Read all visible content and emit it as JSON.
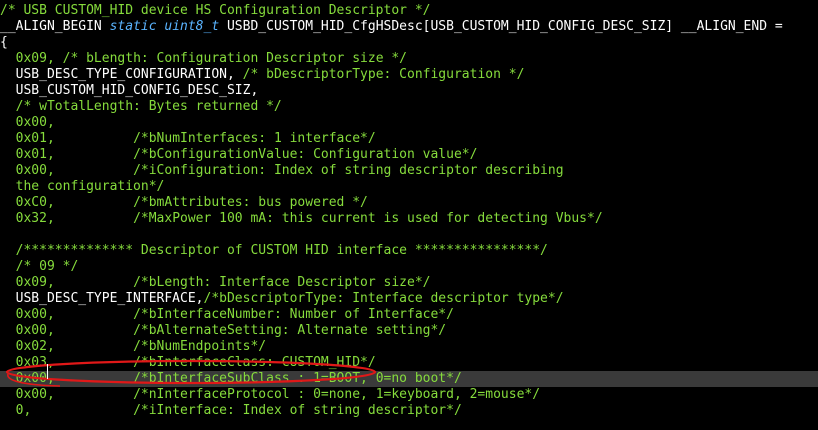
{
  "editor": {
    "colors": {
      "background": "#000000",
      "comment": "#86dc3c",
      "number": "#86dc3c",
      "keyword": "#5ab4ff",
      "plain": "#ffffff",
      "current_line": "#3a3a3a",
      "annotation": "#e01818"
    },
    "current_line_index": 23,
    "lines": [
      [
        {
          "t": "/* USB CUSTOM_HID device HS Configuration Descriptor */",
          "s": "comment"
        }
      ],
      [
        {
          "t": "__ALIGN_BEGIN ",
          "s": "plain"
        },
        {
          "t": "static uint8_t",
          "s": "keyword"
        },
        {
          "t": " USBD_CUSTOM_HID_CfgHSDesc[USB_CUSTOM_HID_CONFIG_DESC_SIZ] __ALIGN_END =",
          "s": "plain"
        }
      ],
      [
        {
          "t": "{",
          "s": "plain"
        }
      ],
      [
        {
          "t": "  0x09, ",
          "s": "number"
        },
        {
          "t": "/* bLength: Configuration Descriptor size */",
          "s": "comment"
        }
      ],
      [
        {
          "t": "  USB_DESC_TYPE_CONFIGURATION, ",
          "s": "plain"
        },
        {
          "t": "/* bDescriptorType: Configuration */",
          "s": "comment"
        }
      ],
      [
        {
          "t": "  USB_CUSTOM_HID_CONFIG_DESC_SIZ,",
          "s": "plain"
        }
      ],
      [
        {
          "t": "  /* wTotalLength: Bytes returned */",
          "s": "comment"
        }
      ],
      [
        {
          "t": "  0x00,",
          "s": "number"
        }
      ],
      [
        {
          "t": "  0x01,          ",
          "s": "number"
        },
        {
          "t": "/*bNumInterfaces: 1 interface*/",
          "s": "comment"
        }
      ],
      [
        {
          "t": "  0x01,          ",
          "s": "number"
        },
        {
          "t": "/*bConfigurationValue: Configuration value*/",
          "s": "comment"
        }
      ],
      [
        {
          "t": "  0x00,          ",
          "s": "number"
        },
        {
          "t": "/*iConfiguration: Index of string descriptor describing",
          "s": "comment"
        }
      ],
      [
        {
          "t": "  the configuration*/",
          "s": "comment"
        }
      ],
      [
        {
          "t": "  0xC0,          ",
          "s": "number"
        },
        {
          "t": "/*bmAttributes: bus powered */",
          "s": "comment"
        }
      ],
      [
        {
          "t": "  0x32,          ",
          "s": "number"
        },
        {
          "t": "/*MaxPower 100 mA: this current is used for detecting Vbus*/",
          "s": "comment"
        }
      ],
      [],
      [
        {
          "t": "  /************** Descriptor of CUSTOM HID interface ****************/",
          "s": "comment"
        }
      ],
      [
        {
          "t": "  /* 09 */",
          "s": "comment"
        }
      ],
      [
        {
          "t": "  0x09,          ",
          "s": "number"
        },
        {
          "t": "/*bLength: Interface Descriptor size*/",
          "s": "comment"
        }
      ],
      [
        {
          "t": "  USB_DESC_TYPE_INTERFACE,",
          "s": "plain"
        },
        {
          "t": "/*bDescriptorType: Interface descriptor type*/",
          "s": "comment"
        }
      ],
      [
        {
          "t": "  0x00,          ",
          "s": "number"
        },
        {
          "t": "/*bInterfaceNumber: Number of Interface*/",
          "s": "comment"
        }
      ],
      [
        {
          "t": "  0x00,          ",
          "s": "number"
        },
        {
          "t": "/*bAlternateSetting: Alternate setting*/",
          "s": "comment"
        }
      ],
      [
        {
          "t": "  0x02,          ",
          "s": "number"
        },
        {
          "t": "/*bNumEndpoints*/",
          "s": "comment"
        }
      ],
      [
        {
          "t": "  0x03,          ",
          "s": "number"
        },
        {
          "t": "/*bInterfaceClass: CUSTOM_HID*/",
          "s": "comment"
        }
      ],
      [
        {
          "t": "  0x00,          ",
          "s": "number"
        },
        {
          "t": "/*bInterfaceSubClass : 1=BOOT, 0=no boot*/",
          "s": "comment"
        }
      ],
      [
        {
          "t": "  0x00,          ",
          "s": "number"
        },
        {
          "t": "/*nInterfaceProtocol : 0=none, 1=keyboard, 2=mouse*/",
          "s": "comment"
        }
      ],
      [
        {
          "t": "  0,             ",
          "s": "number"
        },
        {
          "t": "/*iInterface: Index of string descriptor*/",
          "s": "comment"
        }
      ]
    ]
  }
}
